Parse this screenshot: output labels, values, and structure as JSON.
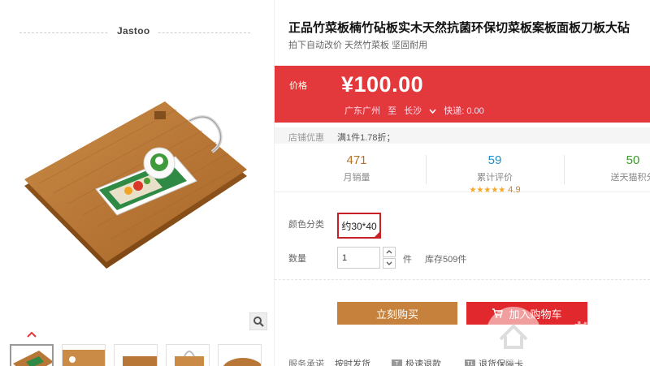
{
  "store": {
    "brand": "Jastoo"
  },
  "gallery": {
    "image_description_icon": "cutting-board-image",
    "zoom_icon": "magnifier-icon",
    "up_icon": "chevron-up-icon",
    "thumbnails": 5
  },
  "product": {
    "title": "正品竹菜板楠竹砧板实木天然抗菌环保切菜板案板面板刀板大砧",
    "subtitle": "拍下自动改价 天然竹菜板 坚固耐用"
  },
  "price": {
    "label": "价格",
    "value": "¥100.00",
    "ship_from": "广东广州",
    "ship_to_word": "至",
    "ship_to": "长沙",
    "shipping": "快递: 0.00"
  },
  "promo": {
    "label": "店铺优惠",
    "text": "满1件1.78折；"
  },
  "stats": {
    "sales": {
      "value": "471",
      "label": "月销量",
      "color": "#b5722a"
    },
    "reviews": {
      "value": "59",
      "label": "累计评价",
      "color": "#1f8ec6",
      "stars": "★★★★★",
      "rating": "4.9"
    },
    "points": {
      "value": "50",
      "label": "送天猫积分",
      "color": "#3a9a28"
    }
  },
  "options": {
    "color_label": "颜色分类",
    "selected_sku": "约30*40",
    "qty_label": "数量",
    "qty_value": "1",
    "unit": "件",
    "stock": "库存509件"
  },
  "actions": {
    "buy_now": "立刻购买",
    "add_to_cart": "加入购物车"
  },
  "services": {
    "label": "服务承诺",
    "items": [
      "按时发货",
      "极速退款",
      "退货保障卡"
    ],
    "badges": [
      "T",
      "T1"
    ]
  },
  "watermark": {
    "text": "68教育"
  },
  "colors": {
    "accent_red": "#e4393c",
    "buy_brown": "#c6823c",
    "cart_red": "#e1282c"
  }
}
